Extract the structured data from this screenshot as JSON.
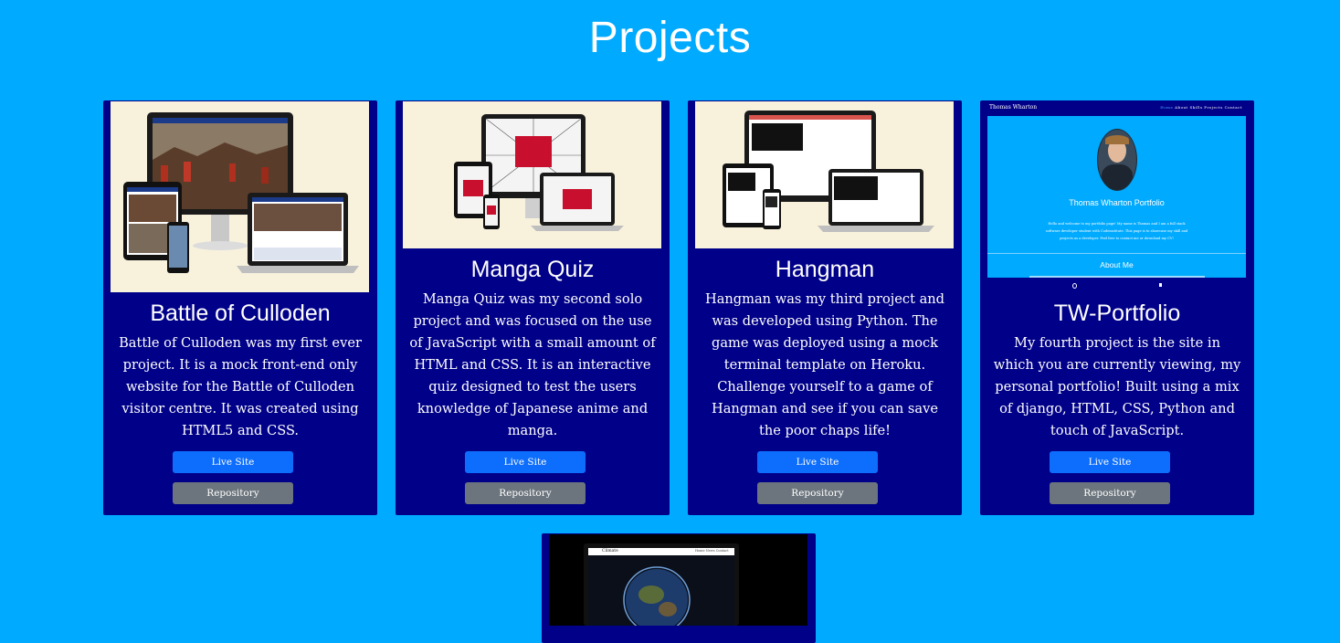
{
  "page": {
    "title": "Projects"
  },
  "projects": [
    {
      "title": "Battle of Culloden",
      "description": "Battle of Culloden was my first ever project. It is a mock front-end only website for the Battle of Culloden visitor centre. It was created using HTML5 and CSS.",
      "live_label": "Live Site",
      "repo_label": "Repository"
    },
    {
      "title": "Manga Quiz",
      "description": "Manga Quiz was my second solo project and was focused on the use of JavaScript with a small amount of HTML and CSS. It is an interactive quiz designed to test the users knowledge of Japanese anime and manga.",
      "live_label": "Live Site",
      "repo_label": "Repository"
    },
    {
      "title": "Hangman",
      "description": "Hangman was my third project and was developed using Python. The game was deployed using a mock terminal template on Heroku. Challenge yourself to a game of Hangman and see if you can save the poor chaps life!",
      "live_label": "Live Site",
      "repo_label": "Repository"
    },
    {
      "title": "TW-Portfolio",
      "description": "My fourth project is the site in which you are currently viewing, my personal portfolio! Built using a mix of django, HTML, CSS, Python and touch of JavaScript.",
      "live_label": "Live Site",
      "repo_label": "Repository",
      "preview": {
        "brand": "Thomas Wharton",
        "nav": [
          "Home",
          "About",
          "Skills",
          "Projects",
          "Contact"
        ],
        "heading": "Thomas Wharton Portfolio",
        "intro": "Hello and welcome to my portfolio page! My name is Thomas and I am a full stack software developer student with Codeinstitute. This page is to showcase my skill and projects as a developer. Feel free to contact me or download my CV!",
        "about": "About Me"
      }
    }
  ],
  "fifth_preview": {
    "brand": "Climate",
    "nav": [
      "Home",
      "News",
      "Contact"
    ]
  }
}
